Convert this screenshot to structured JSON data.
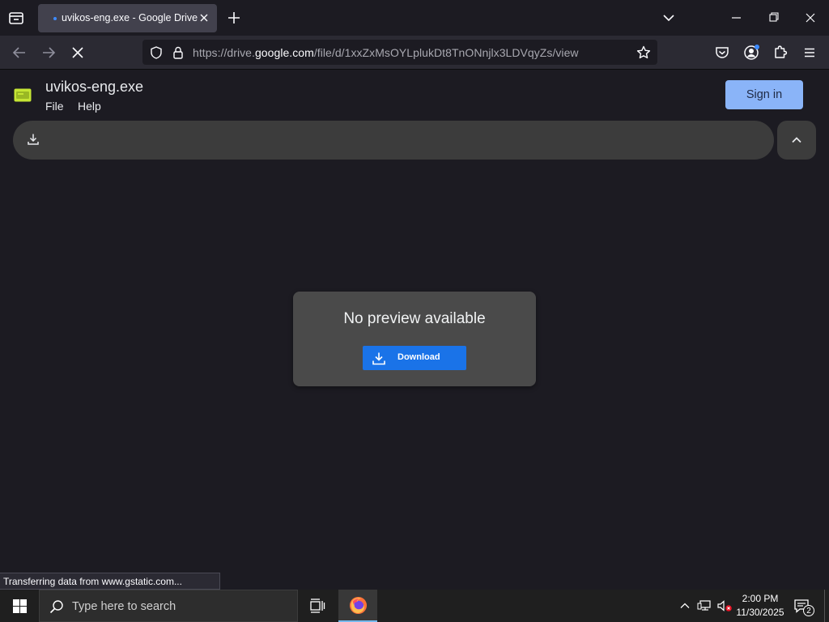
{
  "browser": {
    "tab": {
      "title": "uvikos-eng.exe - Google Drive"
    },
    "url": {
      "prefix": "https://drive.",
      "host": "google.com",
      "path": "/file/d/1xxZxMsOYLplukDt8TnONnjlx3LDVqyZs/view"
    },
    "status_text": "Transferring data from www.gstatic.com..."
  },
  "drive": {
    "file_name": "uvikos-eng.exe",
    "menu": {
      "file": "File",
      "help": "Help"
    },
    "sign_in_label": "Sign in",
    "preview": {
      "message": "No preview available",
      "download_label": "Download"
    }
  },
  "taskbar": {
    "search_placeholder": "Type here to search",
    "clock": {
      "time": "2:00 PM",
      "date": "11/30/2025"
    },
    "notification_count": "2"
  },
  "icons": {
    "tab_list": "tab-list-icon",
    "tab_close": "close-icon",
    "new_tab": "plus-icon",
    "back": "arrow-left-icon",
    "forward": "arrow-right-icon",
    "stop": "stop-icon",
    "shield": "shield-icon",
    "lock": "lock-icon",
    "bookmark": "star-icon",
    "pocket": "pocket-icon",
    "account": "account-icon",
    "extensions": "puzzle-icon",
    "menu": "hamburger-icon",
    "file_type": "drive-file-icon",
    "download": "download-icon",
    "collapse": "chevron-up-icon",
    "windows": "windows-logo-icon",
    "search": "search-icon",
    "task_view": "task-view-icon",
    "firefox": "firefox-icon",
    "network": "network-icon",
    "volume": "volume-muted-icon",
    "notifications": "notification-icon"
  },
  "colors": {
    "sign_in_bg": "#8ab4f8",
    "download_bg": "#1a73e8",
    "tab_loading": "#3d8bff",
    "file_icon": "#c5e534",
    "taskbar_accent": "#76b9ed"
  }
}
